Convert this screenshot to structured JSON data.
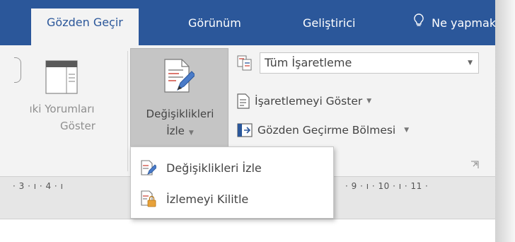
{
  "tabs": [
    {
      "label": "Gözden Geçir",
      "active": true
    },
    {
      "label": "Görünüm"
    },
    {
      "label": "Geliştirici"
    },
    {
      "label": "Ne yapmak istiyorsunuz"
    }
  ],
  "tell_me_icon": "lightbulb-icon",
  "ribbon": {
    "show_comments": {
      "line1": "ıki Yorumları",
      "line2": "Göster"
    },
    "track_changes": {
      "line1": "Değişiklikleri",
      "line2": "İzle"
    },
    "markup_dropdown": {
      "value": "Tüm İşaretleme"
    },
    "show_markup": {
      "label": "İşaretlemeyi Göster"
    },
    "reviewing_pane": {
      "label": "Gözden Geçirme Bölmesi"
    }
  },
  "menu": {
    "items": [
      {
        "label": "Değişiklikleri İzle",
        "icon": "track-changes-icon"
      },
      {
        "label": "İzlemeyi Kilitle",
        "icon": "lock-tracking-icon"
      }
    ]
  },
  "ruler": {
    "left": "· 3 · ı · 4 · ı",
    "right": "· 9 · ı · 10 · ı · 11 ·"
  },
  "colors": {
    "accent": "#2b579a",
    "ribbon_bg": "#f3f3f3"
  }
}
